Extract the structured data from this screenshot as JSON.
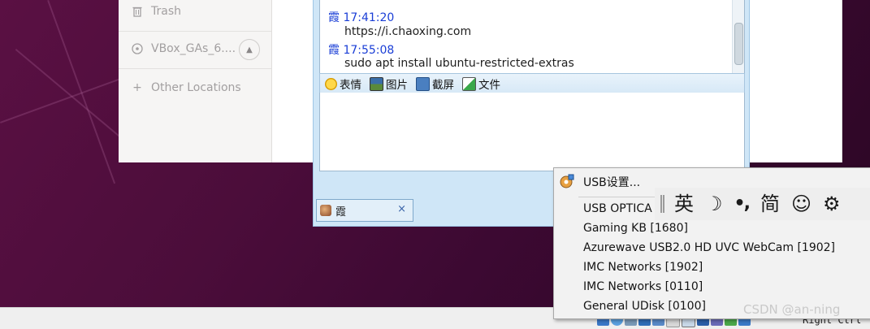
{
  "files_sidebar": {
    "items": [
      {
        "label": "Trash",
        "icon": "trash-icon"
      },
      {
        "label": "VBox_GAs_6....",
        "icon": "disc-icon"
      },
      {
        "label": "Other Locations",
        "icon": "plus-icon"
      }
    ]
  },
  "chat": {
    "messages": [
      {
        "sender": "霞",
        "time": "17:41:20",
        "text": "https://i.chaoxing.com"
      },
      {
        "sender": "霞",
        "time": "17:55:08",
        "text": "sudo apt install ubuntu-restricted-extras"
      }
    ],
    "toolbar": [
      {
        "label": "表情",
        "icon": "emoji-icon"
      },
      {
        "label": "图片",
        "icon": "image-icon"
      },
      {
        "label": "截屏",
        "icon": "screenshot-icon"
      },
      {
        "label": "文件",
        "icon": "file-icon"
      }
    ],
    "tab": {
      "name": "霞",
      "close": "×"
    }
  },
  "usb_menu": {
    "settings": "USB设置...",
    "devices": [
      "USB OPTICA",
      "Gaming KB [1680]",
      "Azurewave USB2.0 HD UVC WebCam [1902]",
      "IMC Networks  [1902]",
      "IMC Networks  [0110]",
      "General UDisk [0100]"
    ]
  },
  "ime": {
    "lang": "英",
    "moon": "☽",
    "punct": "•,",
    "simp": "简",
    "smile": "☺",
    "gear": "⚙"
  },
  "statusbar": {
    "host_key": "Right Ctrl"
  },
  "watermark": "CSDN @an-ning",
  "colors": {
    "desktop": "#4b0d3a",
    "chat_bg": "#cfe6f7",
    "timestamp": "#1a3ed6"
  }
}
